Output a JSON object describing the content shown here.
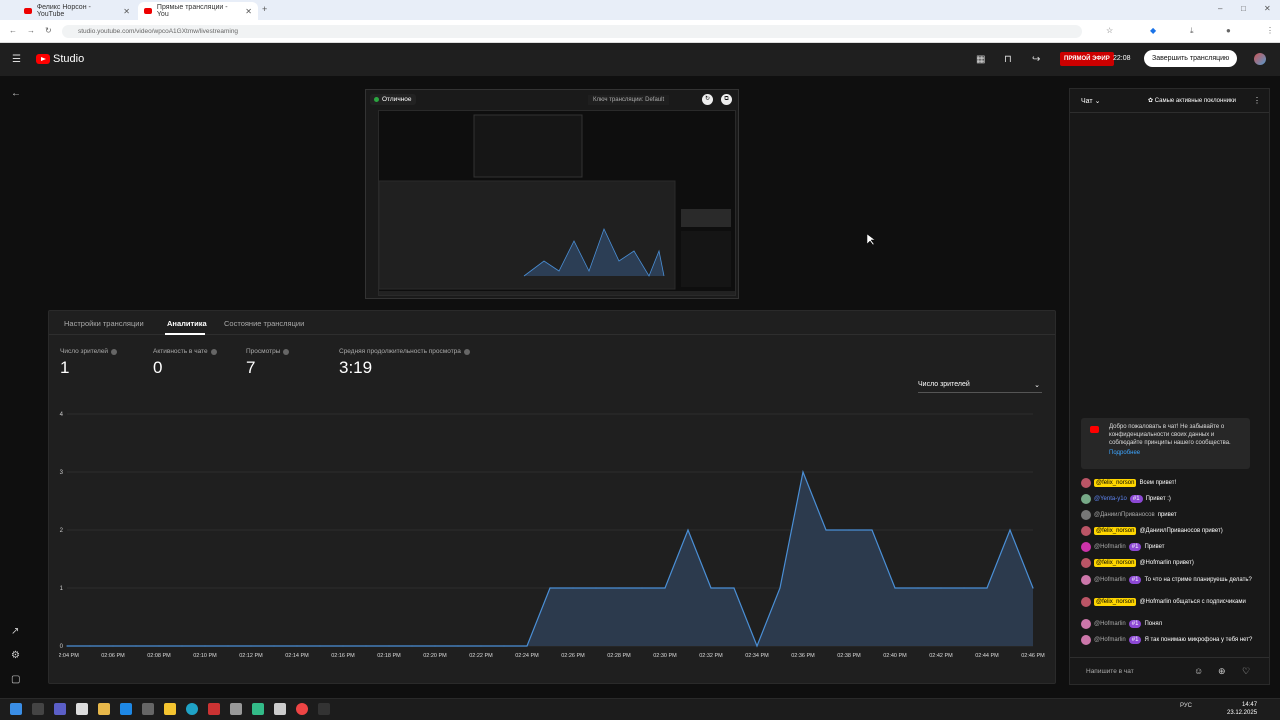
{
  "browser": {
    "tabs": [
      {
        "title": "Феликс Норсон - YouTube"
      },
      {
        "title": "Прямые трансляции - You"
      }
    ],
    "url": "studio.youtube.com/video/wpcoA1GXtmw/livestreaming"
  },
  "header": {
    "logo": "Studio",
    "live_badge": "ПРЯМОЙ ЭФИР",
    "live_time": "22:08",
    "end_button": "Завершить трансляцию"
  },
  "preview": {
    "status": "Отличное",
    "stream_key": "Ключ трансляции: Default"
  },
  "analytics": {
    "tabs": [
      "Настройки трансляции",
      "Аналитика",
      "Состояние трансляции"
    ],
    "active_tab": "Аналитика",
    "metrics": [
      {
        "label": "Число зрителей",
        "value": "1"
      },
      {
        "label": "Активность в чате",
        "value": "0"
      },
      {
        "label": "Просмотры",
        "value": "7"
      },
      {
        "label": "Средняя продолжительность просмотра",
        "value": "3:19"
      }
    ],
    "dropdown": "Число зрителей"
  },
  "chart_data": {
    "type": "area",
    "x": [
      "02:04 PM",
      "02:05 PM",
      "02:06 PM",
      "02:07 PM",
      "02:08 PM",
      "02:09 PM",
      "02:10 PM",
      "02:11 PM",
      "02:12 PM",
      "02:13 PM",
      "02:14 PM",
      "02:15 PM",
      "02:16 PM",
      "02:17 PM",
      "02:18 PM",
      "02:19 PM",
      "02:20 PM",
      "02:21 PM",
      "02:22 PM",
      "02:23 PM",
      "02:24 PM",
      "02:25 PM",
      "02:26 PM",
      "02:27 PM",
      "02:28 PM",
      "02:29 PM",
      "02:30 PM",
      "02:31 PM",
      "02:32 PM",
      "02:33 PM",
      "02:34 PM",
      "02:35 PM",
      "02:36 PM",
      "02:37 PM",
      "02:38 PM",
      "02:39 PM",
      "02:40 PM",
      "02:41 PM",
      "02:42 PM",
      "02:43 PM",
      "02:44 PM",
      "02:45 PM",
      "02:46 PM"
    ],
    "tick_labels": [
      "02:04 PM",
      "02:06 PM",
      "02:08 PM",
      "02:10 PM",
      "02:12 PM",
      "02:14 PM",
      "02:16 PM",
      "02:18 PM",
      "02:20 PM",
      "02:22 PM",
      "02:24 PM",
      "02:26 PM",
      "02:28 PM",
      "02:30 PM",
      "02:32 PM",
      "02:34 PM",
      "02:36 PM",
      "02:38 PM",
      "02:40 PM",
      "02:42 PM",
      "02:44 PM",
      "02:46 PM"
    ],
    "values": [
      0,
      0,
      0,
      0,
      0,
      0,
      0,
      0,
      0,
      0,
      0,
      0,
      0,
      0,
      0,
      0,
      0,
      0,
      0,
      0,
      0,
      1,
      1,
      1,
      1,
      1,
      1,
      2,
      1,
      1,
      0,
      1,
      3,
      2,
      2,
      2,
      1,
      1,
      1,
      1,
      1,
      2,
      1
    ],
    "yticks": [
      0,
      1,
      2,
      3,
      4
    ],
    "ylim": [
      0,
      4
    ],
    "xlabel": "",
    "ylabel": "",
    "grid": true
  },
  "chat": {
    "title": "Чат",
    "filter": "Самые активные поклонники",
    "welcome": "Добро пожаловать в чат! Не забывайте о конфиденциальности своих данных и соблюдайте принципы нашего сообщества.",
    "more": "Подробнее",
    "messages": [
      {
        "author": "@felix_norson",
        "owner": true,
        "text": "Всем привет!"
      },
      {
        "author": "@Yenta-y1o",
        "badge": "#1",
        "mod": true,
        "text": "Привет :)"
      },
      {
        "author": "@ДаниилПриваносов",
        "text": "привет"
      },
      {
        "author": "@felix_norson",
        "owner": true,
        "text": "@ДаниилПриваносов привет)"
      },
      {
        "author": "@Hofmarlin",
        "badge": "#1",
        "text": "Привет"
      },
      {
        "author": "@felix_norson",
        "owner": true,
        "text": "@Hofmarlin привет)"
      },
      {
        "author": "@Hofmarlin",
        "badge": "#1",
        "text": "То что на стриме планируешь делать?"
      },
      {
        "author": "@felix_norson",
        "owner": true,
        "text": "@Hofmarlin общаться с подписчиками"
      },
      {
        "author": "@Hofmarlin",
        "badge": "#1",
        "text": "Понял"
      },
      {
        "author": "@Hofmarlin",
        "badge": "#1",
        "text": "Я так понимаю микрофона у тебя нет?"
      }
    ],
    "input_placeholder": "Напишите в чат"
  },
  "taskbar": {
    "lang": "РУС",
    "time": "14:47",
    "date": "23.12.2025"
  },
  "colors": {
    "accent": "#3ea6ff",
    "live": "#cc0000",
    "chart_line": "#4a8fd6"
  }
}
